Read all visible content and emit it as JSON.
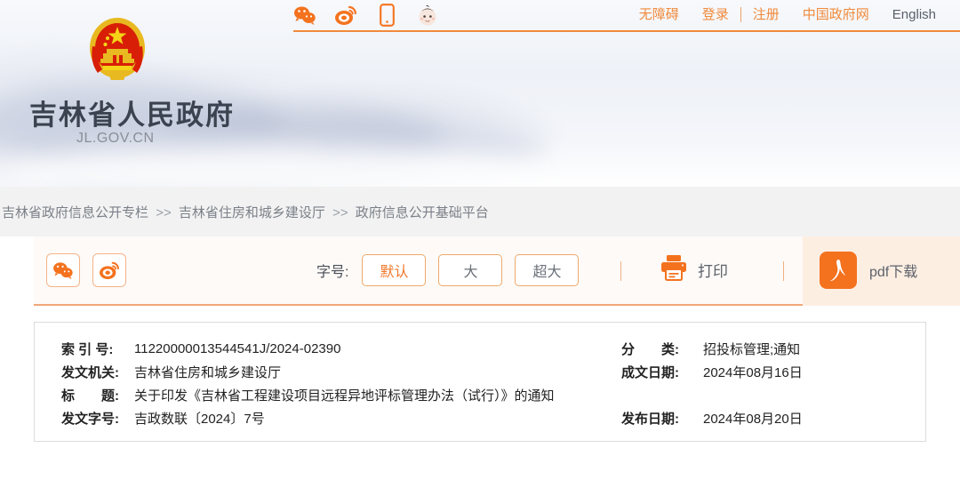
{
  "header": {
    "site_title": "吉林省人民政府",
    "site_domain": "JL.GOV.CN",
    "emblem_name": "national-emblem-china",
    "social_icons": [
      {
        "name": "wechat-icon",
        "label": "微信"
      },
      {
        "name": "weibo-icon",
        "label": "微博"
      },
      {
        "name": "mobile-icon",
        "label": "手机版"
      },
      {
        "name": "mascot-icon",
        "label": "吉祥物"
      }
    ],
    "nav": [
      {
        "name": "accessibility-link",
        "label": "无障碍",
        "style": "orange"
      },
      {
        "name": "login-link",
        "label": "登录",
        "style": "orange"
      },
      {
        "name": "register-link",
        "label": "注册",
        "style": "orange"
      },
      {
        "name": "china-gov-link",
        "label": "中国政府网",
        "style": "orange"
      },
      {
        "name": "english-link",
        "label": "English",
        "style": "dark"
      }
    ]
  },
  "breadcrumb": {
    "separator": ">>",
    "items": [
      "吉林省政府信息公开专栏",
      "吉林省住房和城乡建设厅",
      "政府信息公开基础平台"
    ]
  },
  "toolbar": {
    "share_wechat_label": "微信分享",
    "share_weibo_label": "微博分享",
    "fontsize_label": "字号:",
    "fontsize_options": [
      {
        "label": "默认",
        "active": true
      },
      {
        "label": "大",
        "active": false
      },
      {
        "label": "超大",
        "active": false
      }
    ],
    "print_label": "打印",
    "pdf_label": "pdf下载"
  },
  "meta": {
    "rows": [
      {
        "left_label": "索 引 号:",
        "left_value": "11220000013544541J/2024-02390",
        "right_label": "分　　类:",
        "right_value": "招投标管理;通知"
      },
      {
        "left_label": "发文机关:",
        "left_value": "吉林省住房和城乡建设厅",
        "right_label": "成文日期:",
        "right_value": "2024年08月16日"
      },
      {
        "left_label": "标　　题:",
        "left_value": "关于印发《吉林省工程建设项目远程异地评标管理办法（试行）》的通知",
        "right_label": "",
        "right_value": ""
      },
      {
        "left_label": "发文字号:",
        "left_value": "吉政数联〔2024〕7号",
        "right_label": "发布日期:",
        "right_value": "2024年08月20日"
      }
    ]
  },
  "colors": {
    "accent_orange": "#f0772a",
    "nav_orange": "#f08a3c",
    "breadcrumb_bg": "#f2f2f2",
    "toolbar_bg": "#fdfaf7",
    "pdf_zone_bg": "#fdeee2",
    "text_dark": "#222222"
  }
}
